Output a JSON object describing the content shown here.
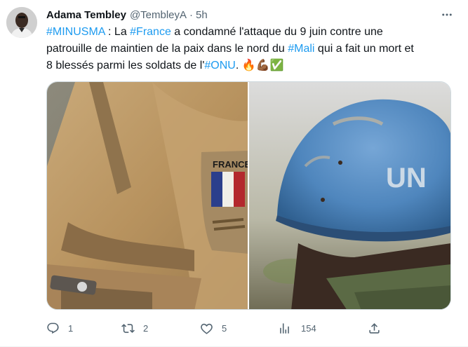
{
  "tweet": {
    "author_name": "Adama Tembley",
    "handle": "@TembleyA",
    "separator": "·",
    "time": "5h",
    "more_icon": "more-horizontal-icon",
    "text": {
      "line1": [
        {
          "t": "#MINUSMA",
          "tag": true
        },
        {
          "t": " : La ",
          "tag": false
        },
        {
          "t": "#France",
          "tag": true
        },
        {
          "t": " a condamné l'attaque du 9 juin contre une",
          "tag": false
        }
      ],
      "line2": [
        {
          "t": "patrouille de maintien de la paix dans le nord du ",
          "tag": false
        },
        {
          "t": "#Mali",
          "tag": true
        },
        {
          "t": " qui a fait un mort et",
          "tag": false
        }
      ],
      "line3": [
        {
          "t": "8  blessés parmi les soldats de l'",
          "tag": false
        },
        {
          "t": "#ONU",
          "tag": true
        },
        {
          "t": ". 🔥💪🏾✅",
          "tag": false
        }
      ]
    },
    "media": {
      "left_patch_text": "FRANCE",
      "right_helmet_text": "UN"
    },
    "actions": {
      "reply_count": "1",
      "retweet_count": "2",
      "like_count": "5",
      "views_count": "154"
    },
    "colors": {
      "link": "#1d9bf0",
      "muted": "#536471",
      "helmet_blue": "#4f86bd"
    }
  }
}
